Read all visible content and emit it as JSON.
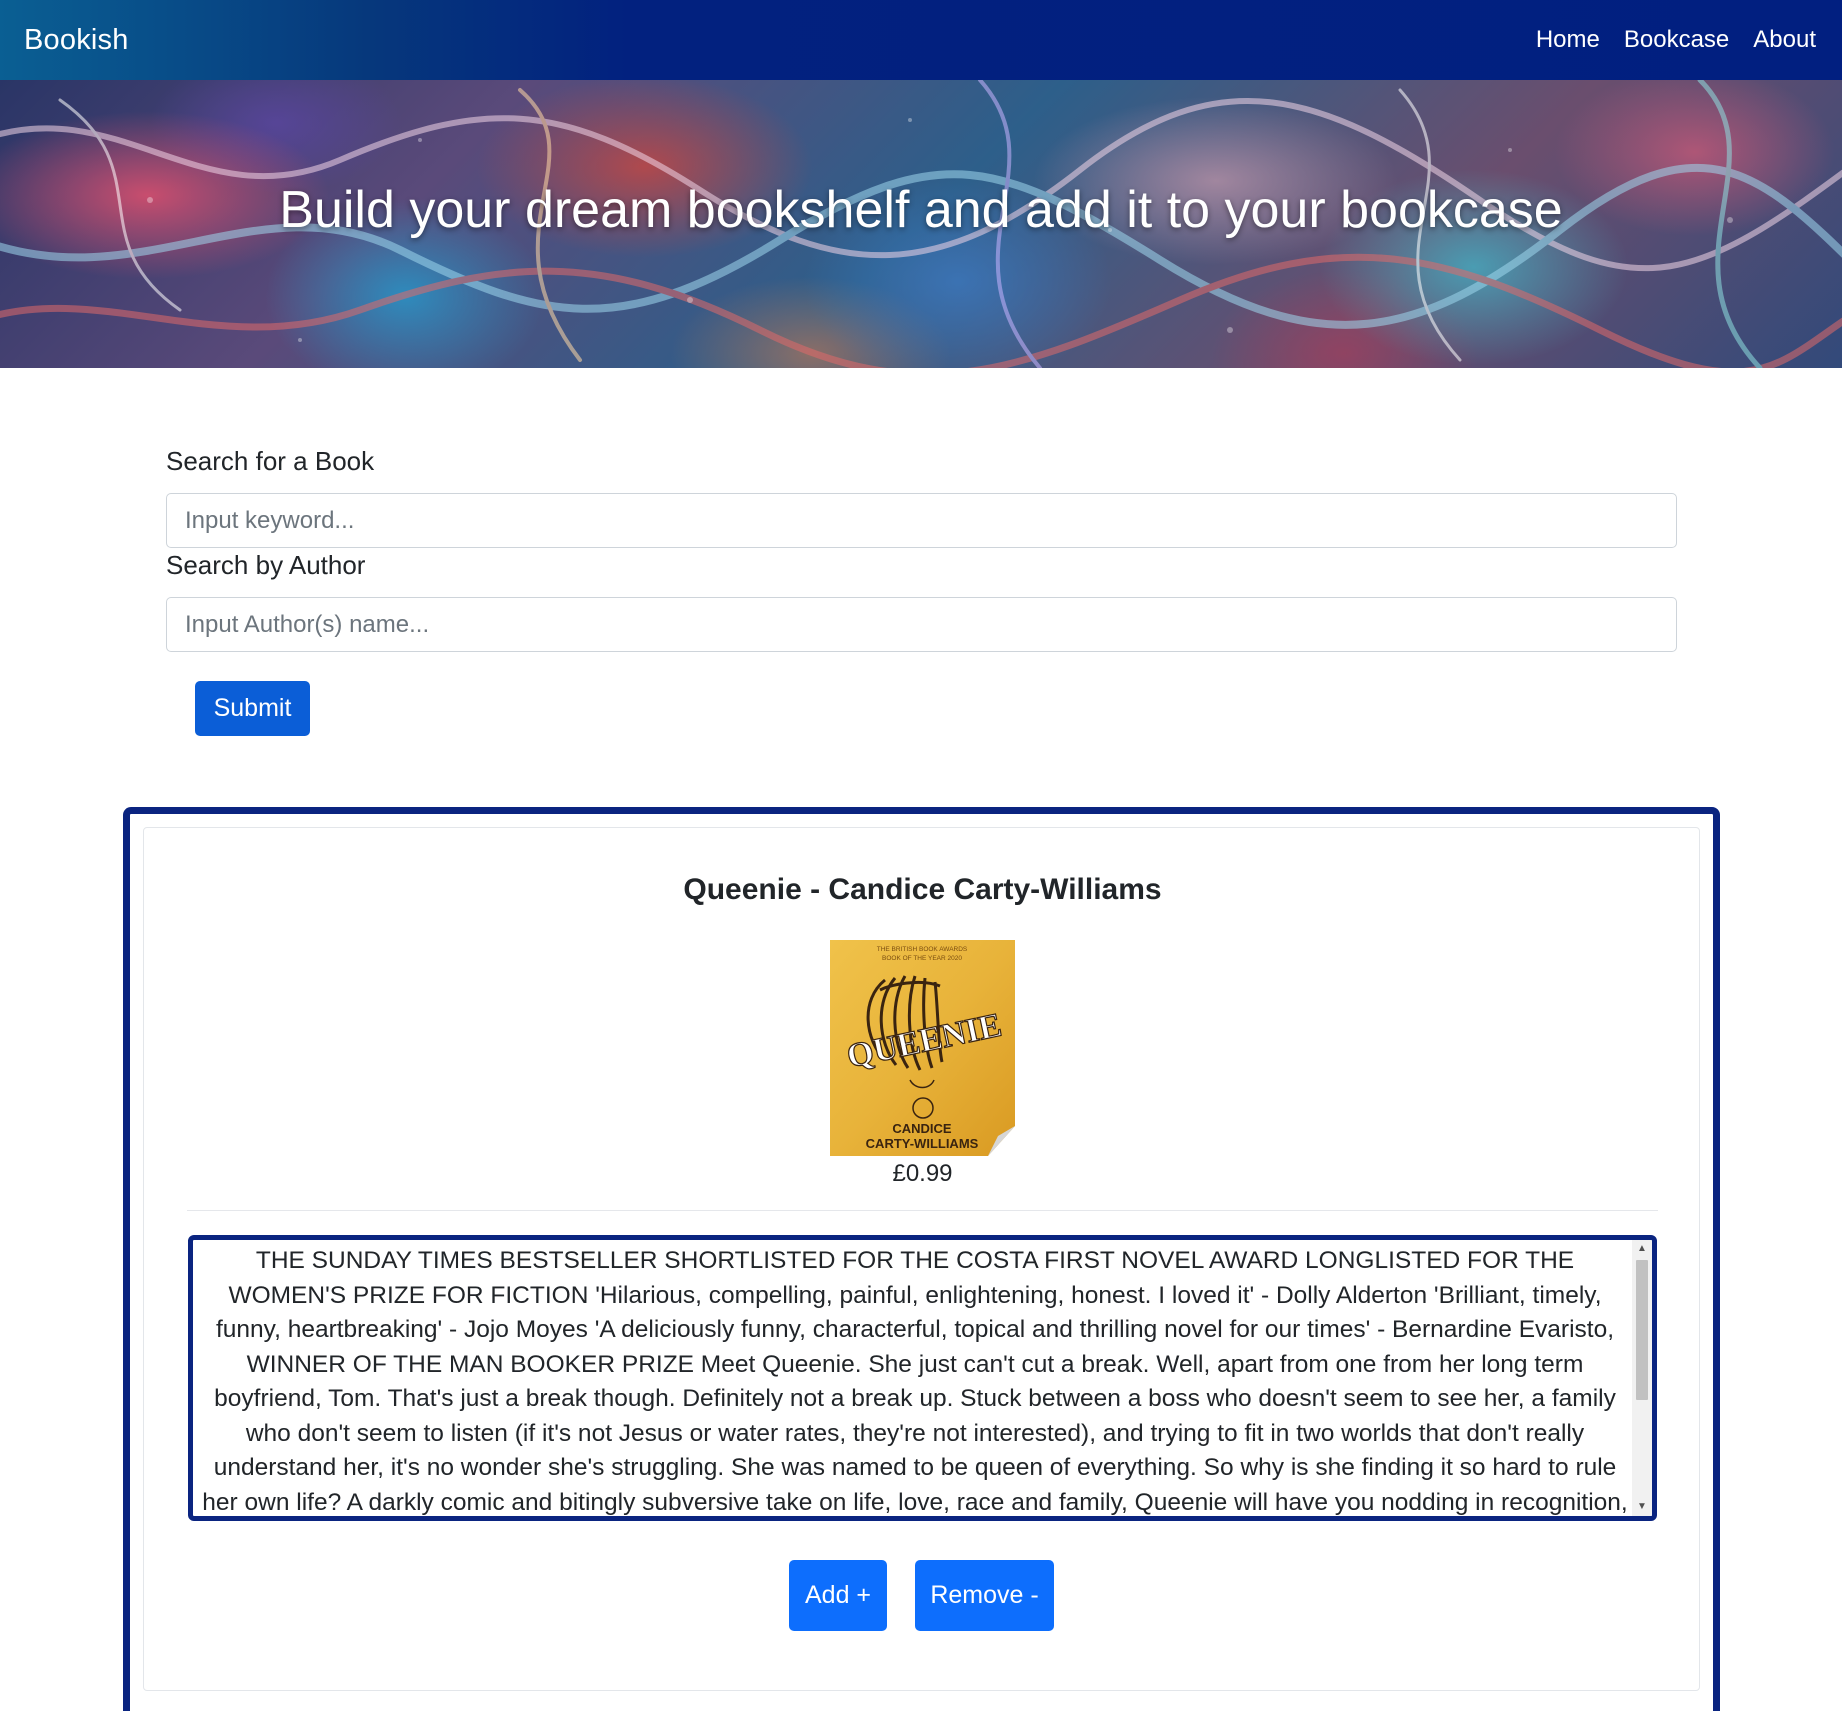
{
  "navbar": {
    "brand": "Bookish",
    "links": [
      "Home",
      "Bookcase",
      "About"
    ]
  },
  "hero": {
    "title": "Build your dream bookshelf and add it to your bookcase"
  },
  "search": {
    "book_label": "Search for a Book",
    "book_placeholder": "Input keyword...",
    "author_label": "Search by Author",
    "author_placeholder": "Input Author(s) name...",
    "submit_label": "Submit"
  },
  "result": {
    "title": "Queenie - Candice Carty-Williams",
    "cover": {
      "award_line1": "THE BRITISH BOOK AWARDS",
      "award_line2": "BOOK OF THE YEAR 2020",
      "title": "QUEENIE",
      "author_line1": "CANDICE",
      "author_line2": "CARTY-WILLIAMS",
      "color": "#e8b33a"
    },
    "price": "£0.99",
    "description": "THE SUNDAY TIMES BESTSELLER SHORTLISTED FOR THE COSTA FIRST NOVEL AWARD LONGLISTED FOR THE WOMEN'S PRIZE FOR FICTION 'Hilarious, compelling, painful, enlightening, honest. I loved it' - Dolly Alderton 'Brilliant, timely, funny, heartbreaking' - Jojo Moyes 'A deliciously funny, characterful, topical and thrilling novel for our times' - Bernardine Evaristo, WINNER OF THE MAN BOOKER PRIZE Meet Queenie. She just can't cut a break. Well, apart from one from her long term boyfriend, Tom. That's just a break though. Definitely not a break up. Stuck between a boss who doesn't seem to see her, a family who don't seem to listen (if it's not Jesus or water rates, they're not interested), and trying to fit in two worlds that don't really understand her, it's no wonder she's struggling. She was named to be queen of everything. So why is she finding it so hard to rule her own life? A darkly comic and bitingly subversive take on life, love, race and family, Queenie will have you nodding in recognition, crying in solidarity and rooting for this unforgettable",
    "add_label": "Add +",
    "remove_label": "Remove -"
  },
  "colors": {
    "accent": "#0a2480",
    "primary_button": "#0d6efd",
    "submit_button": "#0b5ed7"
  }
}
